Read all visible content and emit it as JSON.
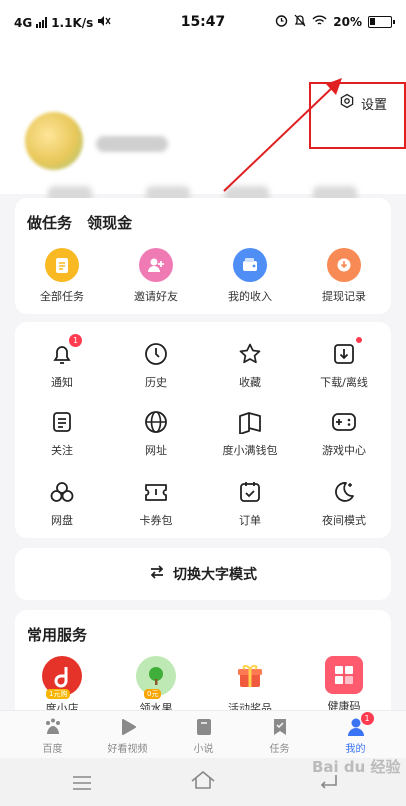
{
  "status": {
    "network": "4G",
    "speed": "1.1K/s",
    "time": "15:47",
    "battery": "20%"
  },
  "header": {
    "settings_label": "设置"
  },
  "tasks": {
    "title": "做任务",
    "subtitle": "领现金",
    "items": [
      {
        "label": "全部任务",
        "icon": "clipboard-icon",
        "color": "#f8b923"
      },
      {
        "label": "邀请好友",
        "icon": "invite-user-icon",
        "color": "#f07ab4"
      },
      {
        "label": "我的收入",
        "icon": "wallet-icon",
        "color": "#4f8ff5"
      },
      {
        "label": "提现记录",
        "icon": "withdraw-icon",
        "color": "#f78a55"
      }
    ]
  },
  "tools": {
    "items": [
      {
        "label": "通知",
        "icon": "bell-icon",
        "badge": "1"
      },
      {
        "label": "历史",
        "icon": "clock-icon"
      },
      {
        "label": "收藏",
        "icon": "star-icon"
      },
      {
        "label": "下载/离线",
        "icon": "download-icon",
        "dot": true
      },
      {
        "label": "关注",
        "icon": "follow-list-icon"
      },
      {
        "label": "网址",
        "icon": "globe-icon"
      },
      {
        "label": "度小满钱包",
        "icon": "wallet-book-icon"
      },
      {
        "label": "游戏中心",
        "icon": "gamepad-icon"
      },
      {
        "label": "网盘",
        "icon": "cloud-drive-icon"
      },
      {
        "label": "卡券包",
        "icon": "ticket-icon"
      },
      {
        "label": "订单",
        "icon": "order-icon"
      },
      {
        "label": "夜间模式",
        "icon": "moon-icon"
      }
    ]
  },
  "switch_mode": {
    "label": "切换大字模式"
  },
  "services": {
    "title": "常用服务",
    "items": [
      {
        "label": "度小店",
        "tag": "1元购"
      },
      {
        "label": "领水果",
        "tag": "0元"
      },
      {
        "label": "活动奖品",
        "tag": ""
      },
      {
        "label": "健康码",
        "tag": ""
      }
    ]
  },
  "tabbar": {
    "items": [
      {
        "label": "百度",
        "active": false
      },
      {
        "label": "好看视频",
        "active": false
      },
      {
        "label": "小说",
        "active": false
      },
      {
        "label": "任务",
        "active": false
      },
      {
        "label": "我的",
        "active": true,
        "badge": "1"
      }
    ]
  },
  "watermark": "Bai du 经验",
  "colors": {
    "accent": "#3b73f5",
    "badge": "#ff3b4f",
    "annotation": "#e02020"
  }
}
